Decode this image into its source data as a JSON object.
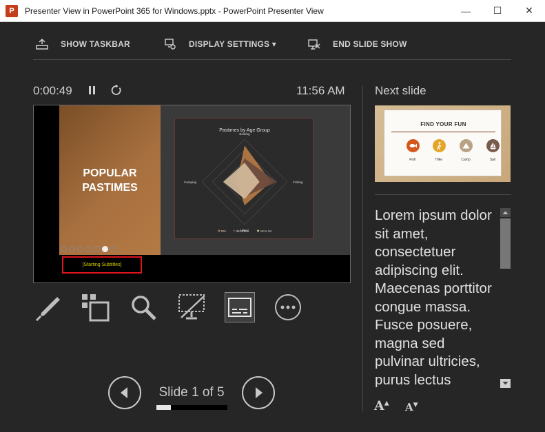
{
  "window": {
    "app_icon_letter": "P",
    "title": "Presenter View in PowerPoint 365 for Windows.pptx - PowerPoint Presenter View",
    "minimize_glyph": "—",
    "maximize_glyph": "☐",
    "close_glyph": "✕"
  },
  "toolbar": {
    "show_taskbar": "SHOW TASKBAR",
    "display_settings": "DISPLAY SETTINGS ▾",
    "end_slide_show": "END SLIDE SHOW"
  },
  "timer": {
    "elapsed": "0:00:49",
    "clock": "11:56 AM"
  },
  "current_slide": {
    "title_line1": "POPULAR",
    "title_line2": "PASTIMES",
    "chart_title": "Pastimes by Age Group",
    "subtitle_text": "[Starting Subtitles]",
    "chart_data": {
      "type": "radar",
      "title": "Pastimes by Age Group",
      "categories": [
        "Boating",
        "Fishing",
        "Hiking",
        "Camping"
      ],
      "series": [
        {
          "name": "50+",
          "values": [
            0.85,
            0.62,
            0.55,
            0.18
          ],
          "color": "#b47a45"
        },
        {
          "name": "35 to 50",
          "values": [
            0.55,
            0.75,
            0.35,
            0.25
          ],
          "color": "#6b4a3c"
        },
        {
          "name": "18 to 34",
          "values": [
            0.45,
            0.35,
            0.4,
            0.5
          ],
          "color": "#d4bc9c"
        }
      ],
      "legend_position": "bottom"
    }
  },
  "tools": {
    "pen": "pen-icon",
    "see_all_slides": "slides-grid-icon",
    "zoom": "zoom-icon",
    "black_screen": "black-screen-icon",
    "subtitles": "subtitles-icon",
    "more": "more-options-icon"
  },
  "navigation": {
    "counter": "Slide 1 of 5",
    "current": 1,
    "total": 5,
    "progress_fraction": 0.2
  },
  "next_slide": {
    "label": "Next slide",
    "card_title": "FIND YOUR FUN",
    "items": [
      {
        "label": "Fish",
        "color": "#d4581e"
      },
      {
        "label": "Hike",
        "color": "#e3a62a"
      },
      {
        "label": "Camp",
        "color": "#b9a285"
      },
      {
        "label": "Sail",
        "color": "#7a5a4a"
      }
    ]
  },
  "notes": {
    "text": "Lorem ipsum dolor sit amet, consectetuer adipiscing elit. Maecenas porttitor congue massa. Fusce posuere, magna sed pulvinar ultricies, purus lectus malesuada libero, sit amet commodo magna eros quis urna.",
    "increase_font": "A",
    "decrease_font": "A"
  }
}
